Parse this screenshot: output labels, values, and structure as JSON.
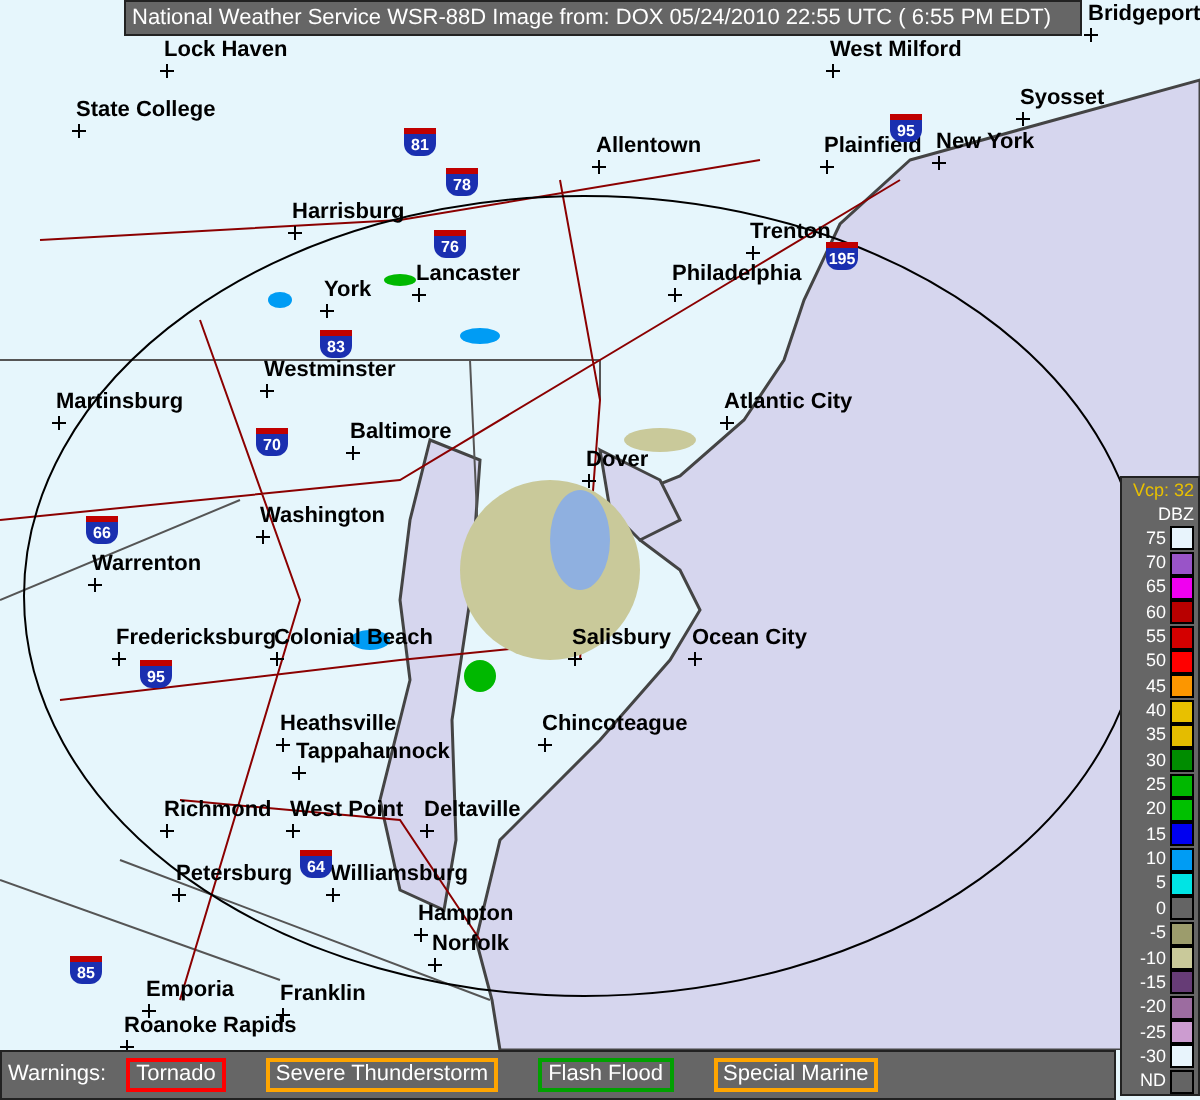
{
  "title": "National Weather Service WSR-88D Image from: DOX 05/24/2010 22:55 UTC ( 6:55 PM EDT)",
  "cities": [
    "Bridgeport",
    "Lock Haven",
    "West Milford",
    "Syosset",
    "State College",
    "Allentown",
    "Plainfield",
    "New York",
    "Harrisburg",
    "Trenton",
    "Lancaster",
    "Philadelphia",
    "York",
    "Westminster",
    "Martinsburg",
    "Atlantic City",
    "Baltimore",
    "Dover",
    "Washington",
    "Warrenton",
    "Fredericksburg",
    "Colonial Beach",
    "Salisbury",
    "Ocean City",
    "Heathsville",
    "Chincoteague",
    "Tappahannock",
    "Richmond",
    "West Point",
    "Deltaville",
    "Petersburg",
    "Williamsburg",
    "Hampton",
    "Norfolk",
    "Emporia",
    "Franklin",
    "Roanoke Rapids"
  ],
  "highways": [
    "81",
    "78",
    "76",
    "83",
    "70",
    "66",
    "95",
    "64",
    "85",
    "195",
    "95"
  ],
  "legend": {
    "vcp": "Vcp: 32",
    "unit": "DBZ",
    "levels": [
      {
        "label": "75",
        "color": "#e8f4fc"
      },
      {
        "label": "70",
        "color": "#9954c8"
      },
      {
        "label": "65",
        "color": "#f000f0"
      },
      {
        "label": "60",
        "color": "#b80000"
      },
      {
        "label": "55",
        "color": "#d40000"
      },
      {
        "label": "50",
        "color": "#ff0000"
      },
      {
        "label": "45",
        "color": "#fc9600"
      },
      {
        "label": "40",
        "color": "#e8c000"
      },
      {
        "label": "35",
        "color": "#e4bc00"
      },
      {
        "label": "30",
        "color": "#008c00"
      },
      {
        "label": "25",
        "color": "#00b800"
      },
      {
        "label": "20",
        "color": "#00c000"
      },
      {
        "label": "15",
        "color": "#0000f0"
      },
      {
        "label": "10",
        "color": "#009cf4"
      },
      {
        "label": "5",
        "color": "#00e4e4"
      },
      {
        "label": "0",
        "color": "#646464"
      },
      {
        "label": "-5",
        "color": "#9c9c6c"
      },
      {
        "label": "-10",
        "color": "#c9c99a"
      },
      {
        "label": "-15",
        "color": "#663c76"
      },
      {
        "label": "-20",
        "color": "#9c6ca0"
      },
      {
        "label": "-25",
        "color": "#cc9cd0"
      },
      {
        "label": "-30",
        "color": "#e8f4fc"
      },
      {
        "label": "ND",
        "color": "#646464"
      }
    ]
  },
  "warnings": {
    "label": "Warnings:",
    "items": [
      {
        "label": "Tornado",
        "color": "#ff0000"
      },
      {
        "label": "Severe Thunderstorm",
        "color": "#ffa500"
      },
      {
        "label": "Flash Flood",
        "color": "#00a000"
      },
      {
        "label": "Special Marine",
        "color": "#ffa500"
      }
    ]
  }
}
